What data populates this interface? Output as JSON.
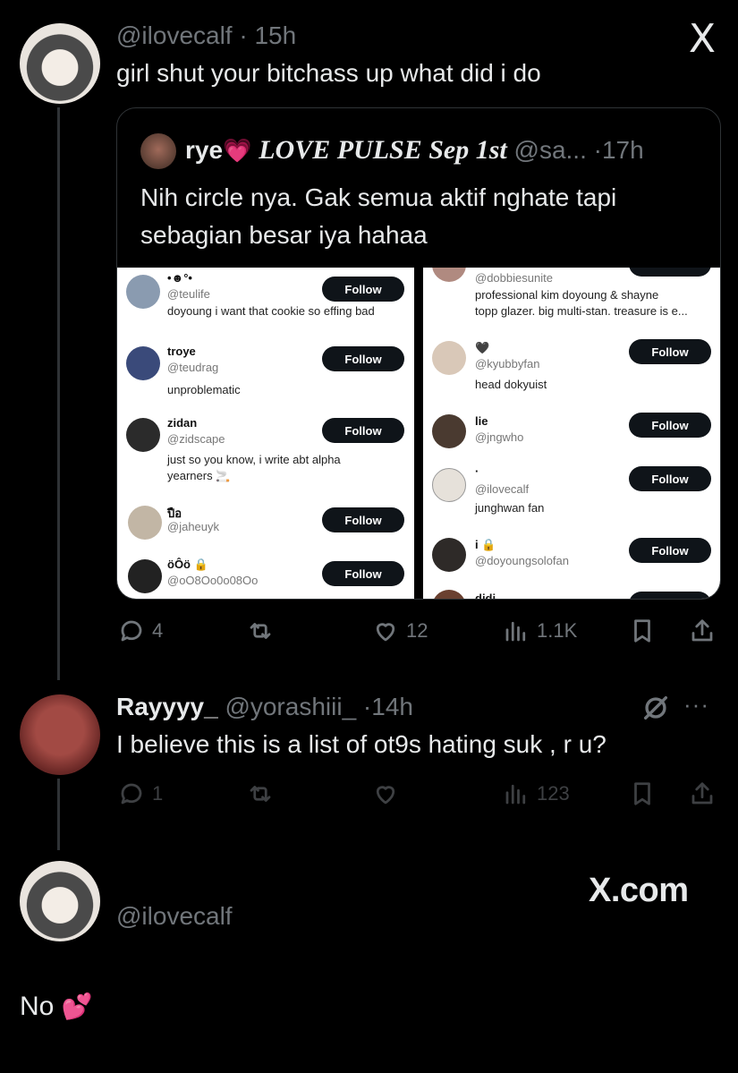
{
  "close_label": "X",
  "tweet1": {
    "handle": "@ilovecalf",
    "sep": "·",
    "time": "15h",
    "text": "girl shut your bitchass up what did i do",
    "quote": {
      "name": "rye",
      "emoji": "💗",
      "subtitle": "LOVE PULSE Sep 1st",
      "handle": "@sa...",
      "sep": "·",
      "time": "17h",
      "text_line1": "Nih circle nya. Gak semua aktif nghate tapi",
      "text_line2": "sebagian besar iya hahaa",
      "follow_label": "Follow",
      "left_list": [
        {
          "name": "•☻°•",
          "handle": "@teulife",
          "bio": "doyoung i want that cookie so effing bad"
        },
        {
          "name": "troye",
          "handle": "@teudrag",
          "bio": "unproblematic"
        },
        {
          "name": "zidan",
          "handle": "@zidscape",
          "bio": "just so you know, i write abt alpha",
          "bio2": "yearners 🚬"
        },
        {
          "name": "ปือ",
          "handle": "@jaheuyk",
          "bio": ""
        },
        {
          "name": "öÔö 🔒",
          "handle": "@oO8Oo0o08Oo",
          "bio": ""
        }
      ],
      "right_list": [
        {
          "name": "",
          "handle": "@dobbiesunite",
          "bio": "professional kim doyoung & shayne",
          "bio2": "topp glazer. big multi-stan. treasure is e..."
        },
        {
          "name": "🖤",
          "handle": "@kyubbyfan",
          "bio": "head dokyuist"
        },
        {
          "name": "lie",
          "handle": "@jngwho",
          "bio": ""
        },
        {
          "name": "·",
          "handle": "@ilovecalf",
          "bio": "junghwan fan"
        },
        {
          "name": "i 🔒",
          "handle": "@doyoungsolofan",
          "bio": ""
        },
        {
          "name": "didi",
          "handle": "",
          "bio": ""
        }
      ]
    },
    "replies": "4",
    "likes": "12",
    "views": "1.1K"
  },
  "tweet2": {
    "name": "Rayyyy_",
    "handle": "@yorashiii_",
    "sep": "·",
    "time": "14h",
    "text": "I believe this is a list of ot9s hating suk , r u?",
    "replies": "1",
    "views": "123",
    "more": "···"
  },
  "tweet3": {
    "handle": "@ilovecalf",
    "watermark": "X.com",
    "text": "No",
    "emoji": "💕"
  }
}
